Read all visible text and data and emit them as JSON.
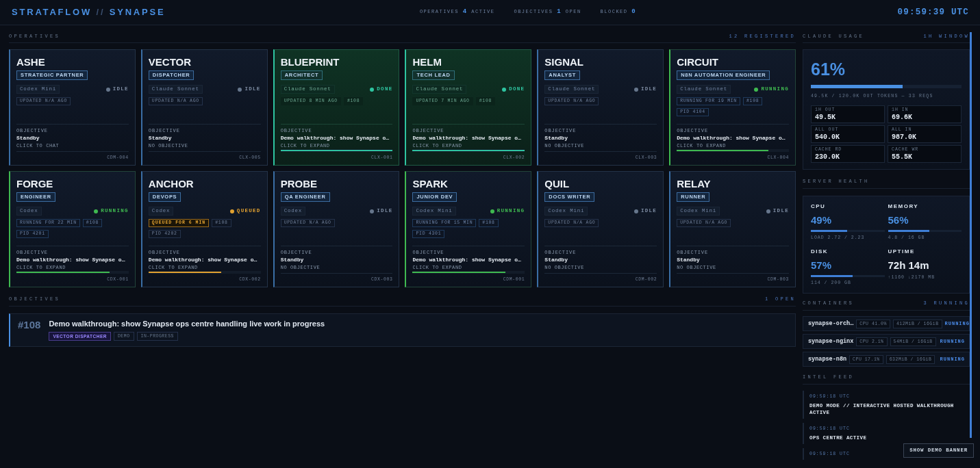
{
  "header": {
    "brand": "STRATAFLOW",
    "separator": "//",
    "product": "SYNAPSE",
    "stats": [
      {
        "label": "OPERATIVES",
        "value": "4",
        "unit": "ACTIVE"
      },
      {
        "label": "OBJECTIVES",
        "value": "1",
        "unit": "OPEN"
      },
      {
        "label": "BLOCKED",
        "value": "0"
      }
    ],
    "clock": "09:59:39 UTC"
  },
  "operatives": {
    "title": "OPERATIVES",
    "count": "12 REGISTERED",
    "agents": [
      {
        "name": "ASHE",
        "role": "STRATEGIC PARTNER",
        "model": "Codex Mini",
        "status": "IDLE",
        "kind": "idle",
        "meta": [
          "UPDATED N/A AGO"
        ],
        "objective_label": "OBJECTIVE",
        "objective": "Standby",
        "hint": "CLICK TO CHAT",
        "code": "CDM-004"
      },
      {
        "name": "VECTOR",
        "role": "DISPATCHER",
        "model": "Claude Sonnet",
        "status": "IDLE",
        "kind": "idle",
        "meta": [
          "UPDATED N/A AGO"
        ],
        "objective_label": "OBJECTIVE",
        "objective": "Standby",
        "hint": "NO OBJECTIVE",
        "code": "CLX-005"
      },
      {
        "name": "BLUEPRINT",
        "role": "ARCHITECT",
        "model": "Claude Sonnet",
        "status": "DONE",
        "kind": "done",
        "meta": [
          "UPDATED 8 MIN AGO",
          "#108"
        ],
        "objective_label": "OBJECTIVE",
        "objective": "Demo walkthrough: show Synapse o…",
        "hint": "CLICK TO EXPAND",
        "level": 1,
        "code": "CLX-001"
      },
      {
        "name": "HELM",
        "role": "TECH LEAD",
        "model": "Claude Sonnet",
        "status": "DONE",
        "kind": "done",
        "meta": [
          "UPDATED 7 MIN AGO",
          "#108"
        ],
        "objective_label": "OBJECTIVE",
        "objective": "Demo walkthrough: show Synapse o…",
        "hint": "CLICK TO EXPAND",
        "level": 1,
        "code": "CLX-002"
      },
      {
        "name": "SIGNAL",
        "role": "ANALYST",
        "model": "Claude Sonnet",
        "status": "IDLE",
        "kind": "idle",
        "meta": [
          "UPDATED N/A AGO"
        ],
        "objective_label": "OBJECTIVE",
        "objective": "Standby",
        "hint": "NO OBJECTIVE",
        "code": "CLX-003"
      },
      {
        "name": "CIRCUIT",
        "role": "N8N AUTOMATION ENGINEER",
        "model": "Claude Sonnet",
        "status": "RUNNING",
        "kind": "running",
        "meta": [
          "RUNNING FOR 19 MIN",
          "#108"
        ],
        "pid": "PID 4104",
        "objective_label": "OBJECTIVE",
        "objective": "Demo walkthrough: show Synapse o…",
        "hint": "CLICK TO EXPAND",
        "level": 0.82,
        "code": "CLX-004"
      },
      {
        "name": "FORGE",
        "role": "ENGINEER",
        "model": "Codex",
        "status": "RUNNING",
        "kind": "running",
        "meta": [
          "RUNNING FOR 22 MIN",
          "#108"
        ],
        "pid": "PID 4201",
        "objective_label": "OBJECTIVE",
        "objective": "Demo walkthrough: show Synapse o…",
        "hint": "CLICK TO EXPAND",
        "level": 0.83,
        "code": "CDX-001"
      },
      {
        "name": "ANCHOR",
        "role": "DEVOPS",
        "model": "Codex",
        "status": "QUEUED",
        "kind": "queued",
        "meta": [
          "QUEUED FOR 6 MIN",
          "#108"
        ],
        "pid": "PID 4202",
        "objective_label": "OBJECTIVE",
        "objective": "Demo walkthrough: show Synapse o…",
        "hint": "CLICK TO EXPAND",
        "level": 0.65,
        "code": "CDX-002"
      },
      {
        "name": "PROBE",
        "role": "QA ENGINEER",
        "model": "Codex",
        "status": "IDLE",
        "kind": "idle",
        "meta": [
          "UPDATED N/A AGO"
        ],
        "objective_label": "OBJECTIVE",
        "objective": "Standby",
        "hint": "NO OBJECTIVE",
        "code": "CDX-003"
      },
      {
        "name": "SPARK",
        "role": "JUNIOR DEV",
        "model": "Codex Mini",
        "status": "RUNNING",
        "kind": "running",
        "meta": [
          "RUNNING FOR 15 MIN",
          "#108"
        ],
        "pid": "PID 4301",
        "objective_label": "OBJECTIVE",
        "objective": "Demo walkthrough: show Synapse o…",
        "hint": "CLICK TO EXPAND",
        "level": 0.83,
        "code": "CDM-001"
      },
      {
        "name": "QUIL",
        "role": "DOCS WRITER",
        "model": "Codex Mini",
        "status": "IDLE",
        "kind": "idle",
        "meta": [
          "UPDATED N/A AGO"
        ],
        "objective_label": "OBJECTIVE",
        "objective": "Standby",
        "hint": "NO OBJECTIVE",
        "code": "CDM-002"
      },
      {
        "name": "RELAY",
        "role": "RUNNER",
        "model": "Codex Mini",
        "status": "IDLE",
        "kind": "idle",
        "meta": [
          "UPDATED N/A AGO"
        ],
        "objective_label": "OBJECTIVE",
        "objective": "Standby",
        "hint": "NO OBJECTIVE",
        "code": "CDM-003"
      }
    ]
  },
  "objectives": {
    "title": "OBJECTIVES",
    "count": "1 OPEN",
    "items": [
      {
        "number": "#108",
        "title": "Demo walkthrough: show Synapse ops centre handling live work in progress",
        "tags": [
          {
            "text": "VECTOR DISPATCHER",
            "kind": "assignee"
          },
          {
            "text": "DEMO",
            "kind": "plain"
          },
          {
            "text": "IN-PROGRESS",
            "kind": "plain"
          }
        ]
      }
    ]
  },
  "usage": {
    "title": "CLAUDE USAGE",
    "window": "1H WINDOW",
    "percent": "61%",
    "level": 0.61,
    "summary": "49.5K / 120.0K OUT TOKENS — 33 REQS",
    "stats": [
      {
        "label": "1H OUT",
        "value": "49.5K"
      },
      {
        "label": "1H IN",
        "value": "69.6K"
      },
      {
        "label": "ALL OUT",
        "value": "540.0K"
      },
      {
        "label": "ALL IN",
        "value": "987.0K"
      },
      {
        "label": "CACHE RD",
        "value": "230.0K"
      },
      {
        "label": "CACHE WR",
        "value": "55.5K"
      }
    ]
  },
  "server_health": {
    "title": "SERVER HEALTH",
    "metrics": [
      {
        "kind": "percent",
        "label": "CPU",
        "value": "49%",
        "level": 0.49,
        "detail": "LOAD 2.72 / 2.23"
      },
      {
        "kind": "percent",
        "label": "MEMORY",
        "value": "56%",
        "level": 0.56,
        "detail": "4.8 / 16 GB"
      },
      {
        "kind": "percent",
        "label": "DISK",
        "value": "57%",
        "level": 0.57,
        "detail": "114 / 200 GB"
      },
      {
        "kind": "duration",
        "label": "UPTIME",
        "value": "72h 14m",
        "detail": "↑1160 ↓2170 MB"
      }
    ]
  },
  "containers": {
    "title": "CONTAINERS",
    "count": "3 RUNNING",
    "items": [
      {
        "name": "synapse-orch…",
        "cpu": "CPU 41.0%",
        "memory": "412MiB / 16GiB",
        "status": "RUNNING"
      },
      {
        "name": "synapse-nginx",
        "cpu": "CPU 2.1%",
        "memory": "54MiB / 16GiB",
        "status": "RUNNING"
      },
      {
        "name": "synapse-n8n",
        "cpu": "CPU 17.1%",
        "memory": "632MiB / 16GiB",
        "status": "RUNNING"
      }
    ]
  },
  "intel_feed": {
    "title": "INTEL FEED",
    "entries": [
      {
        "time": "09:59:18 UTC",
        "message": "DEMO MODE // INTERACTIVE HOSTED WALKTHROUGH ACTIVE"
      },
      {
        "time": "09:59:18 UTC",
        "message": "OPS CENTRE ACTIVE"
      },
      {
        "time": "09:59:18 UTC"
      }
    ]
  },
  "demo_banner_button": "SHOW DEMO BANNER"
}
